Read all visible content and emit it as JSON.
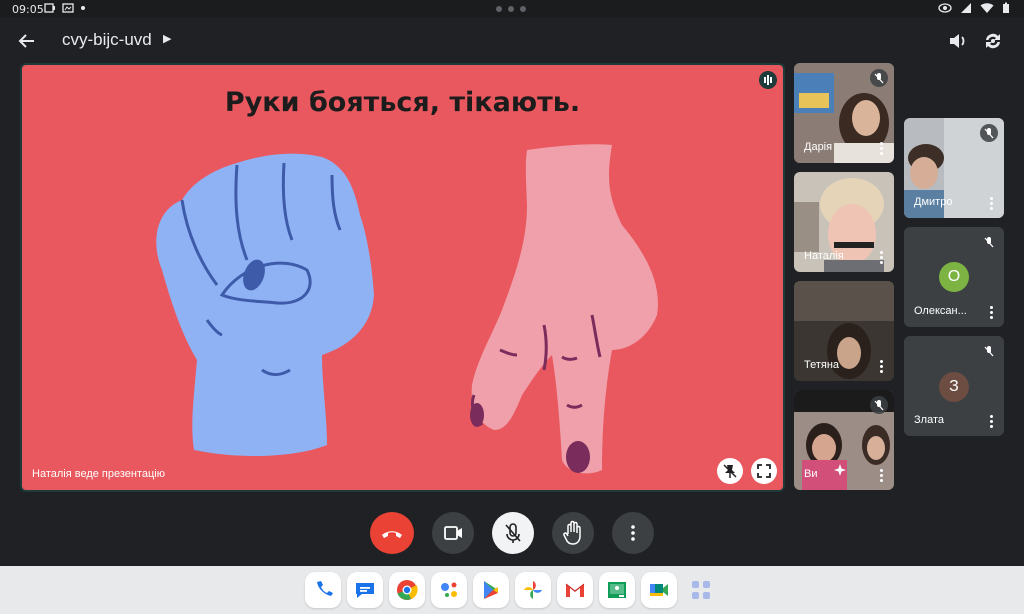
{
  "status_bar": {
    "time": "09:05",
    "right_icons": [
      "eye-icon",
      "signal-icon",
      "wifi-icon",
      "battery-icon"
    ]
  },
  "app_bar": {
    "meeting_code": "cvy-bijc-uvd",
    "actions": [
      "speaker-icon",
      "switch-camera-icon"
    ]
  },
  "presentation": {
    "slide_title": "Руки бояться, тікають.",
    "presenter_label": "Наталія веде презентацію",
    "colors": {
      "background": "#e8585e",
      "fist": "#8fb2f5",
      "hand": "#f0a0aa",
      "nails": "#7a2c5c"
    }
  },
  "participants": [
    {
      "name": "Дарія",
      "muted": true,
      "type": "video"
    },
    {
      "name": "Наталія",
      "muted": false,
      "type": "video"
    },
    {
      "name": "Тетяна",
      "muted": false,
      "type": "video"
    },
    {
      "name": "Ви",
      "muted": true,
      "type": "video"
    },
    {
      "name": "Дмитро",
      "muted": true,
      "type": "video"
    },
    {
      "name": "Олексан...",
      "muted": true,
      "type": "avatar",
      "initial": "О",
      "avatar_color": "#7cb342"
    },
    {
      "name": "Злата",
      "muted": true,
      "type": "avatar",
      "initial": "З",
      "avatar_color": "#6d4c41"
    }
  ],
  "controls": [
    "end-call-icon",
    "camera-icon",
    "mic-off-icon",
    "raise-hand-icon",
    "more-options-icon"
  ],
  "dock": [
    "phone-app",
    "messages-app",
    "chrome-app",
    "assistant-app",
    "play-store-app",
    "photos-app",
    "gmail-app",
    "classroom-app",
    "meet-app",
    "all-apps"
  ]
}
